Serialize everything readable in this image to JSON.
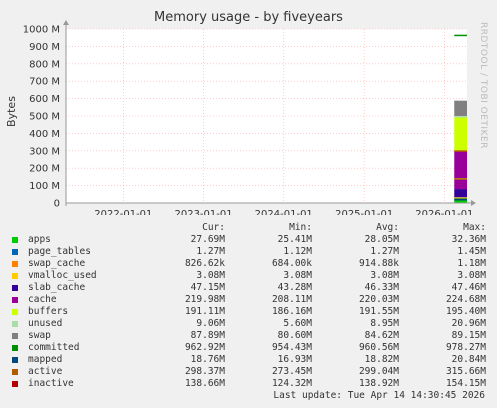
{
  "title": "Memory usage - by fiveyears",
  "watermark": "RRDTOOL / TOBI OETIKER",
  "colors": {
    "background": "#f0f0f0",
    "plot_background": "#ffffff",
    "grid": "#ffaaaa",
    "axis": "#999999"
  },
  "chart_data": {
    "type": "area",
    "title": "Memory usage - by fiveyears",
    "ylabel": "Bytes",
    "ylim": [
      0,
      1000000000
    ],
    "yticks": [
      {
        "value": 0,
        "label": "0"
      },
      {
        "value": 100000000,
        "label": "100 M"
      },
      {
        "value": 200000000,
        "label": "200 M"
      },
      {
        "value": 300000000,
        "label": "300 M"
      },
      {
        "value": 400000000,
        "label": "400 M"
      },
      {
        "value": 500000000,
        "label": "500 M"
      },
      {
        "value": 600000000,
        "label": "600 M"
      },
      {
        "value": 700000000,
        "label": "700 M"
      },
      {
        "value": 800000000,
        "label": "800 M"
      },
      {
        "value": 900000000,
        "label": "900 M"
      },
      {
        "value": 1000000000,
        "label": "1000 M"
      }
    ],
    "xlim": [
      "2021-04-15",
      "2026-04-14"
    ],
    "xticks": [
      "2022-01-01",
      "2023-01-01",
      "2024-01-01",
      "2025-01-01",
      "2026-01-01"
    ],
    "data_start": "2026-02-15",
    "grid": true,
    "stack": [
      {
        "name": "apps",
        "color": "#00cc00",
        "value": 27690000
      },
      {
        "name": "page_tables",
        "color": "#0066b3",
        "value": 1270000
      },
      {
        "name": "swap_cache",
        "color": "#ff8000",
        "value": 826620
      },
      {
        "name": "vmalloc_used",
        "color": "#ffcc00",
        "value": 3080000
      },
      {
        "name": "slab_cache",
        "color": "#330099",
        "value": 47150000
      },
      {
        "name": "cache",
        "color": "#990099",
        "value": 219980000
      },
      {
        "name": "buffers",
        "color": "#ccff00",
        "value": 191110000
      },
      {
        "name": "unused",
        "color": "#aaddaa",
        "value": 9060000
      },
      {
        "name": "swap",
        "color": "#808080",
        "value": 87890000
      }
    ],
    "lines": [
      {
        "name": "committed",
        "color": "#008f00",
        "value": 962920000
      },
      {
        "name": "mapped",
        "color": "#00487d",
        "value": 18760000
      },
      {
        "name": "active",
        "color": "#b35a00",
        "value": 298370000
      },
      {
        "name": "inactive",
        "color": "#b38f00",
        "value": 138660000
      }
    ]
  },
  "legend": {
    "headers": {
      "cur": "Cur:",
      "min": "Min:",
      "avg": "Avg:",
      "max": "Max:"
    },
    "rows": [
      {
        "name": "apps",
        "color": "#00cc00",
        "cur": "27.69M",
        "min": "25.41M",
        "avg": "28.05M",
        "max": "32.36M"
      },
      {
        "name": "page_tables",
        "color": "#0066b3",
        "cur": "1.27M",
        "min": "1.12M",
        "avg": "1.27M",
        "max": "1.45M"
      },
      {
        "name": "swap_cache",
        "color": "#ff8000",
        "cur": "826.62k",
        "min": "684.00k",
        "avg": "914.88k",
        "max": "1.18M"
      },
      {
        "name": "vmalloc_used",
        "color": "#ffcc00",
        "cur": "3.08M",
        "min": "3.08M",
        "avg": "3.08M",
        "max": "3.08M"
      },
      {
        "name": "slab_cache",
        "color": "#330099",
        "cur": "47.15M",
        "min": "43.28M",
        "avg": "46.33M",
        "max": "47.46M"
      },
      {
        "name": "cache",
        "color": "#990099",
        "cur": "219.98M",
        "min": "208.11M",
        "avg": "220.03M",
        "max": "224.68M"
      },
      {
        "name": "buffers",
        "color": "#ccff00",
        "cur": "191.11M",
        "min": "186.16M",
        "avg": "191.55M",
        "max": "195.40M"
      },
      {
        "name": "unused",
        "color": "#aaddaa",
        "cur": "9.06M",
        "min": "5.60M",
        "avg": "8.95M",
        "max": "20.96M"
      },
      {
        "name": "swap",
        "color": "#808080",
        "cur": "87.89M",
        "min": "80.60M",
        "avg": "84.62M",
        "max": "89.15M"
      },
      {
        "name": "committed",
        "color": "#008f00",
        "cur": "962.92M",
        "min": "954.43M",
        "avg": "960.56M",
        "max": "978.27M"
      },
      {
        "name": "mapped",
        "color": "#00487d",
        "cur": "18.76M",
        "min": "16.93M",
        "avg": "18.82M",
        "max": "20.84M"
      },
      {
        "name": "active",
        "color": "#b35a00",
        "cur": "298.37M",
        "min": "273.45M",
        "avg": "299.04M",
        "max": "315.66M"
      },
      {
        "name": "inactive",
        "color": "#b30000",
        "cur": "138.66M",
        "min": "124.32M",
        "avg": "138.92M",
        "max": "154.15M"
      }
    ]
  },
  "last_update": "Last update: Tue Apr 14 14:30:45 2026"
}
